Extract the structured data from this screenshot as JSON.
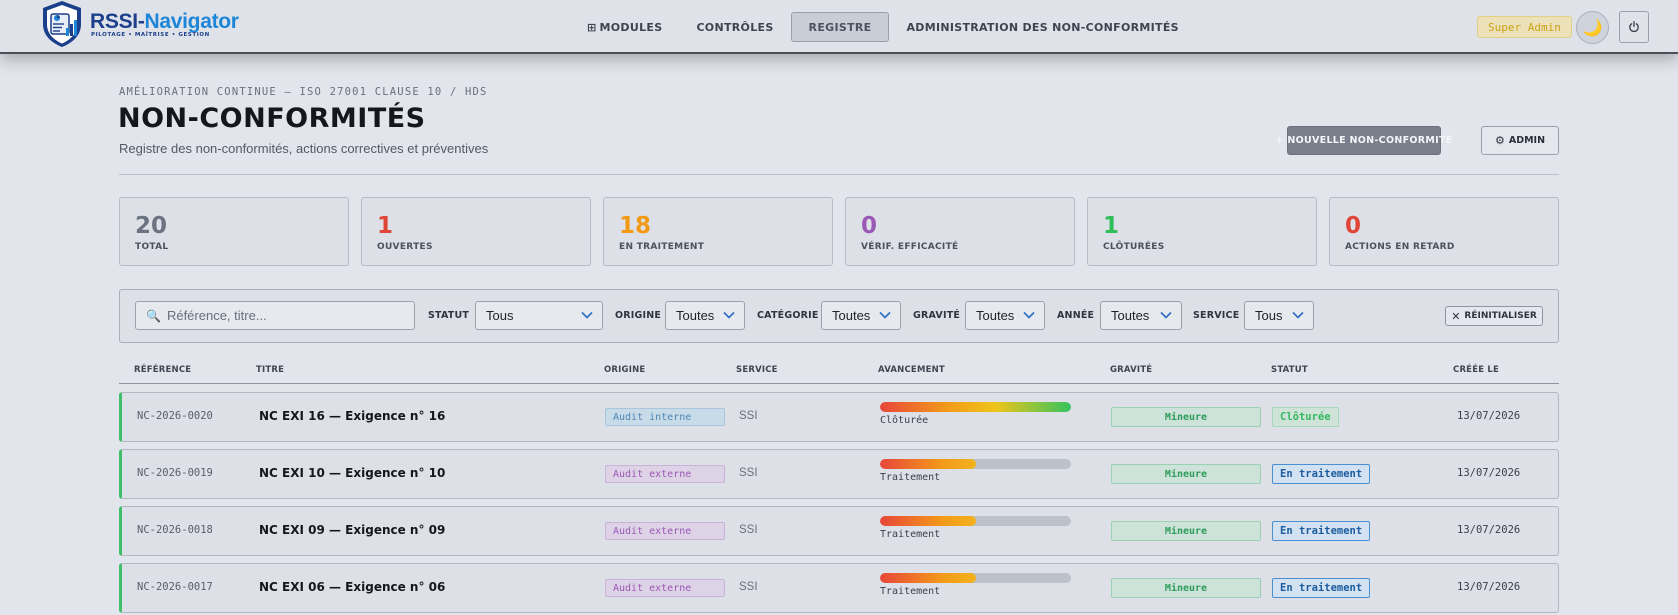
{
  "app": {
    "brand_main": "RSSI-",
    "brand_accent": "Navigator",
    "tagline": "PILOTAGE • MAÎTRISE • GESTION"
  },
  "nav": {
    "items": [
      {
        "label": "Modules",
        "icon": "grid-icon",
        "active": false
      },
      {
        "label": "Contrôles",
        "active": false
      },
      {
        "label": "Registre",
        "active": true
      },
      {
        "label": "Administration des non-conformités",
        "active": false
      }
    ]
  },
  "user": {
    "role": "Super Admin",
    "theme_icon": "moon-icon",
    "logout_icon": "power-icon"
  },
  "header": {
    "eyebrow": "Amélioration continue — ISO 27001 clause 10 / HDS",
    "title": "NON-CONFORMITÉS",
    "subtitle": "Registre des non-conformités, actions correctives et préventives",
    "new_button": "+ Nouvelle non-conformité",
    "admin_button": "Admin"
  },
  "stats": [
    {
      "value": "20",
      "label": "Total",
      "color": "#6c7380"
    },
    {
      "value": "1",
      "label": "Ouvertes",
      "color": "#e04638"
    },
    {
      "value": "18",
      "label": "En traitement",
      "color": "#f29a16"
    },
    {
      "value": "0",
      "label": "Vérif. efficacité",
      "color": "#9b59b6"
    },
    {
      "value": "1",
      "label": "Clôturées",
      "color": "#2fbf5a"
    },
    {
      "value": "0",
      "label": "Actions en retard",
      "color": "#e04638"
    }
  ],
  "filters": {
    "search_placeholder": "Référence, titre...",
    "statut_label": "Statut",
    "statut_value": "Tous",
    "origine_label": "Origine",
    "origine_value": "Toutes",
    "categorie_label": "Catégorie",
    "categorie_value": "Toutes",
    "gravite_label": "Gravité",
    "gravite_value": "Toutes",
    "annee_label": "Année",
    "annee_value": "Toutes",
    "service_label": "Service",
    "service_value": "Tous",
    "reset_label": "Réinitialiser"
  },
  "table": {
    "columns": [
      "Référence",
      "Titre",
      "Origine",
      "Service",
      "Avancement",
      "Gravité",
      "Statut",
      "Créée le"
    ],
    "rows": [
      {
        "ref": "NC-2026-0020",
        "title": "NC EXI 16 — Exigence n° 16",
        "origin": "Audit interne",
        "service": "SSI",
        "progress": 1.0,
        "progress_label": "Clôturée",
        "gravity": "Mineure",
        "status": "Clôturée",
        "created": "13/07/2026"
      },
      {
        "ref": "NC-2026-0019",
        "title": "NC EXI 10 — Exigence n° 10",
        "origin": "Audit externe",
        "service": "SSI",
        "progress": 0.5,
        "progress_label": "Traitement",
        "gravity": "Mineure",
        "status": "En traitement",
        "created": "13/07/2026"
      },
      {
        "ref": "NC-2026-0018",
        "title": "NC EXI 09 — Exigence n° 09",
        "origin": "Audit externe",
        "service": "SSI",
        "progress": 0.5,
        "progress_label": "Traitement",
        "gravity": "Mineure",
        "status": "En traitement",
        "created": "13/07/2026"
      },
      {
        "ref": "NC-2026-0017",
        "title": "NC EXI 06 — Exigence n° 06",
        "origin": "Audit externe",
        "service": "SSI",
        "progress": 0.5,
        "progress_label": "Traitement",
        "gravity": "Mineure",
        "status": "En traitement",
        "created": "13/07/2026"
      }
    ]
  },
  "colors": {
    "row_accent": "#3fbf6a",
    "origin_internal_bg": "#c8dbe8",
    "origin_internal_fg": "#4f86b4",
    "origin_external_bg": "#ddd2e6",
    "origin_external_fg": "#9b58b5",
    "status_closed_fg": "#33b85f",
    "status_closed_bg": "#cfe3d8",
    "status_progress_fg": "#1c5c9e",
    "status_progress_bg": "#d2e2f2"
  }
}
